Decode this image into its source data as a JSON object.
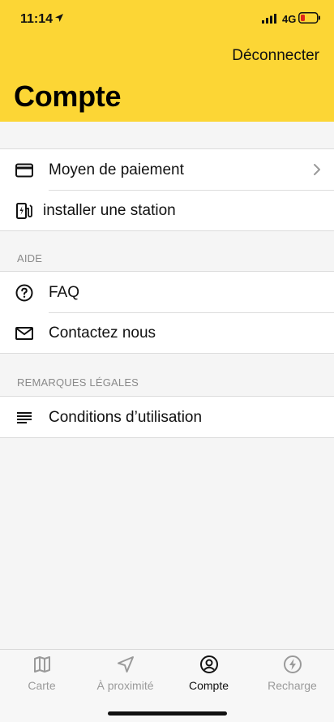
{
  "status_bar": {
    "time": "11:14",
    "network": "4G",
    "icons": [
      "location-arrow-icon",
      "signal-icon",
      "battery-icon"
    ]
  },
  "header": {
    "logout_label": "Déconnecter",
    "title": "Compte",
    "background_color": "#fcd635"
  },
  "account_group": {
    "items": [
      {
        "label": "Moyen de paiement",
        "icon": "credit-card-icon",
        "has_chevron": true
      },
      {
        "label": "installer une station",
        "icon": "charging-station-icon",
        "has_chevron": false
      }
    ]
  },
  "help_section": {
    "title": "AIDE",
    "items": [
      {
        "label": "FAQ",
        "icon": "question-circle-icon"
      },
      {
        "label": "Contactez nous",
        "icon": "mail-icon"
      }
    ]
  },
  "legal_section": {
    "title": "REMARQUES LÉGALES",
    "items": [
      {
        "label": "Conditions d’utilisation",
        "icon": "lines-icon"
      }
    ]
  },
  "tab_bar": {
    "tabs": [
      {
        "label": "Carte",
        "icon": "map-icon",
        "active": false
      },
      {
        "label": "À proximité",
        "icon": "navigation-arrow-icon",
        "active": false
      },
      {
        "label": "Compte",
        "icon": "user-circle-icon",
        "active": true
      },
      {
        "label": "Recharge",
        "icon": "bolt-circle-icon",
        "active": false
      }
    ]
  }
}
